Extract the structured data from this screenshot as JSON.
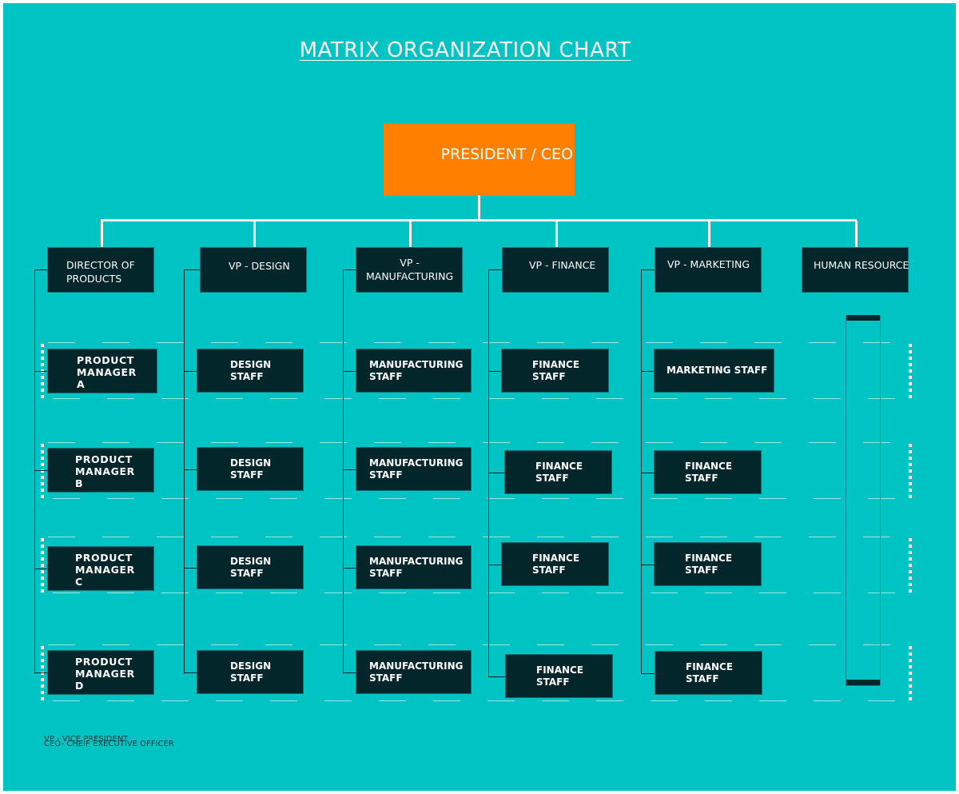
{
  "title": "MATRIX ORGANIZATION CHART",
  "ceo": {
    "label": "PRESIDENT / CEO",
    "color": "#ff8000"
  },
  "departments": [
    {
      "label": "DIRECTOR OF\nPRODUCTS"
    },
    {
      "label": "VP - DESIGN"
    },
    {
      "label": "VP -\nMANUFACTURING"
    },
    {
      "label": "VP - FINANCE"
    },
    {
      "label": "VP - MARKETING"
    },
    {
      "label": "HUMAN RESOURCE"
    }
  ],
  "columns": [
    {
      "name": "products",
      "items": [
        "PRODUCT\nMANAGER\nA",
        "PRODUCT\nMANAGER\nB",
        "PRODUCT\nMANAGER\nC",
        "PRODUCT\nMANAGER\nD"
      ]
    },
    {
      "name": "design",
      "items": [
        "DESIGN\nSTAFF",
        "DESIGN\nSTAFF",
        "DESIGN\nSTAFF",
        "DESIGN\nSTAFF"
      ]
    },
    {
      "name": "manufacturing",
      "items": [
        "MANUFACTURING\nSTAFF",
        "MANUFACTURING\nSTAFF",
        "MANUFACTURING\nSTAFF",
        "MANUFACTURING\nSTAFF"
      ]
    },
    {
      "name": "finance",
      "items": [
        "FINANCE\nSTAFF",
        "FINANCE\nSTAFF",
        "FINANCE\nSTAFF",
        "FINANCE\nSTAFF"
      ]
    },
    {
      "name": "marketing",
      "items": [
        "MARKETING STAFF",
        "FINANCE\nSTAFF",
        "FINANCE\nSTAFF",
        "FINANCE\nSTAFF"
      ]
    }
  ],
  "legend": {
    "line1": "VP - VICE PRESIDENT",
    "line2": "CEO- CHEIF EXECUTIVE OFFICER"
  },
  "colors": {
    "background": "#00c3c3",
    "box": "#02262a",
    "connector": "#ffffff",
    "accent": "#ff8000"
  }
}
